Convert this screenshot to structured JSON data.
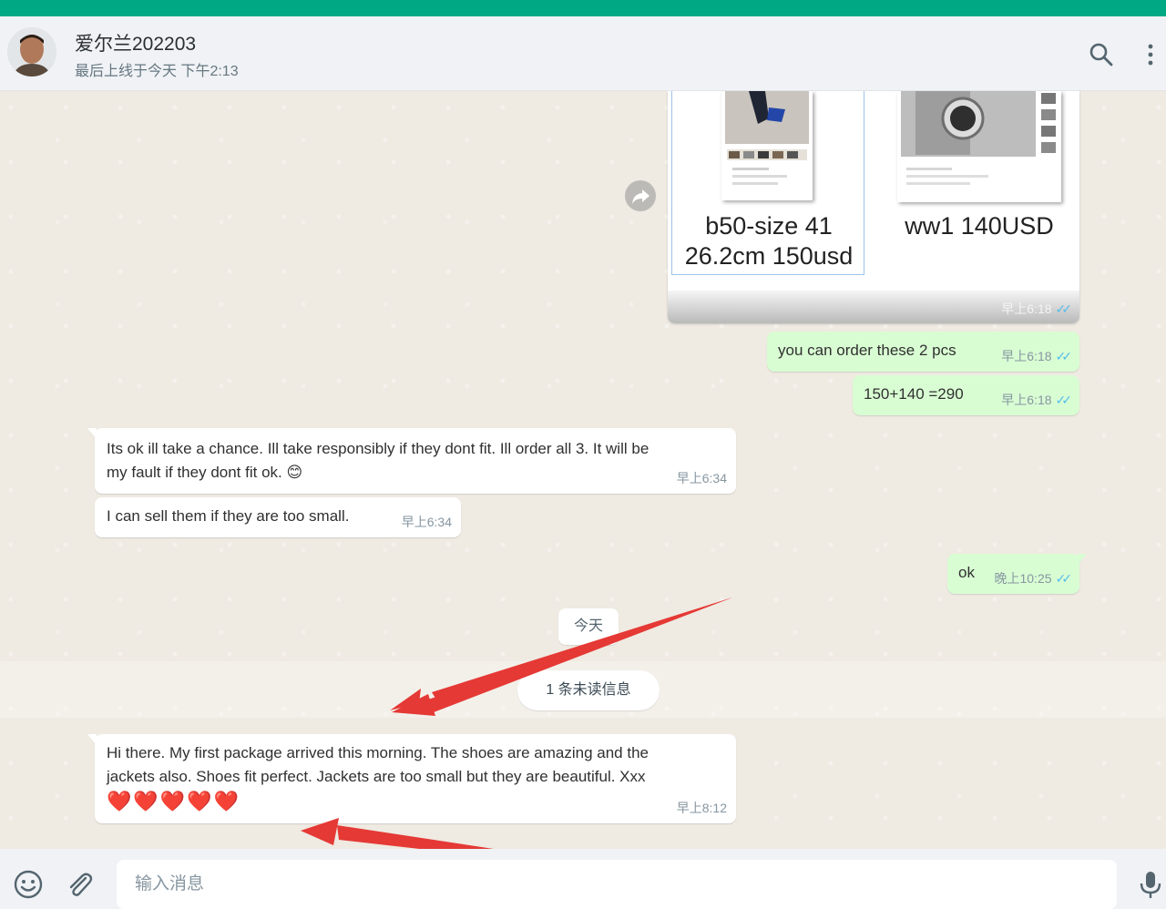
{
  "header": {
    "contact_name": "爱尔兰202203",
    "last_seen": "最后上线于今天 下午2:13",
    "search_icon": "search-icon",
    "menu_icon": "kebab-menu-icon"
  },
  "colors": {
    "accent": "#00a884",
    "outgoing_bubble": "#d9fdd3",
    "incoming_bubble": "#ffffff",
    "read_ticks": "#53bdeb",
    "annotation_arrow": "#e53935"
  },
  "product_card": {
    "items": [
      {
        "caption_line1": "b50-size 41",
        "caption_line2": "26.2cm  150usd"
      },
      {
        "caption_line1": "ww1  140USD",
        "caption_line2": ""
      }
    ],
    "time": "早上6:18"
  },
  "messages": [
    {
      "direction": "out",
      "text": "you can order these 2 pcs",
      "time": "早上6:18",
      "read": true
    },
    {
      "direction": "out",
      "text": "150+140 =290",
      "time": "早上6:18",
      "read": true
    },
    {
      "direction": "in",
      "text_line1": "Its ok ill take a chance. Ill take responsibly if they dont fit. Ill order all 3. It will be",
      "text_line2": "my fault if they dont fit ok. 😊",
      "time": "早上6:34"
    },
    {
      "direction": "in",
      "text": "I can sell them if they are too small.",
      "time": "早上6:34"
    },
    {
      "direction": "out",
      "text": "ok",
      "time": "晚上10:25",
      "read": true
    },
    {
      "direction": "in",
      "text_line1": "Hi there. My first package arrived this morning. The shoes are amazing and the",
      "text_line2": "jackets also. Shoes fit perfect. Jackets are too small but they are beautiful. Xxx",
      "text_line3": "❤️❤️❤️❤️❤️",
      "time": "早上8:12"
    }
  ],
  "date_divider": "今天",
  "unread_divider": "1 条未读信息",
  "composer": {
    "placeholder": "输入消息",
    "emoji_icon": "emoji-icon",
    "attach_icon": "paperclip-icon",
    "mic_icon": "microphone-icon"
  }
}
